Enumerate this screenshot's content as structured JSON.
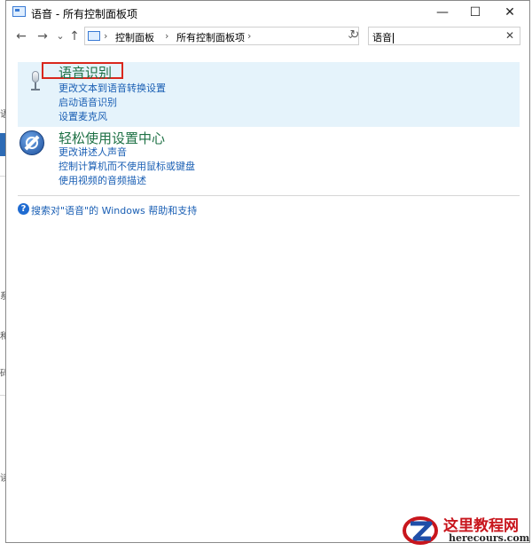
{
  "window": {
    "title": "语音 - 所有控制面板项",
    "minimize": "—",
    "maximize": "☐",
    "close": "✕"
  },
  "nav": {
    "back": "←",
    "forward": "→",
    "recent": "⌄",
    "up": "↑",
    "refresh": "↻"
  },
  "address": {
    "crumbs": [
      "控制面板",
      "所有控制面板项"
    ],
    "separator": "›",
    "dropdown": "⌄"
  },
  "search": {
    "value": "语音",
    "clear": "✕"
  },
  "results": [
    {
      "heading": "语音识别",
      "icon": "microphone-icon",
      "links": [
        "更改文本到语音转换设置",
        "启动语音识别",
        "设置麦克风"
      ]
    },
    {
      "heading": "轻松使用设置中心",
      "icon": "ease-of-access-icon",
      "links": [
        "更改讲述人声音",
        "控制计算机而不使用鼠标或键盘",
        "使用视频的音频描述"
      ]
    }
  ],
  "help": {
    "icon_text": "?",
    "text": "搜索对\"语音\"的 Windows 帮助和支持"
  },
  "watermark": {
    "title": "这里教程网",
    "url": "herecours.com"
  },
  "background": {
    "glyphs": [
      "语",
      "系",
      "和",
      "码",
      "读"
    ]
  },
  "colors": {
    "link": "#1a5fb4",
    "heading": "#1e7145",
    "hover_bg": "#e5f3fb",
    "highlight": "#d9271d"
  }
}
